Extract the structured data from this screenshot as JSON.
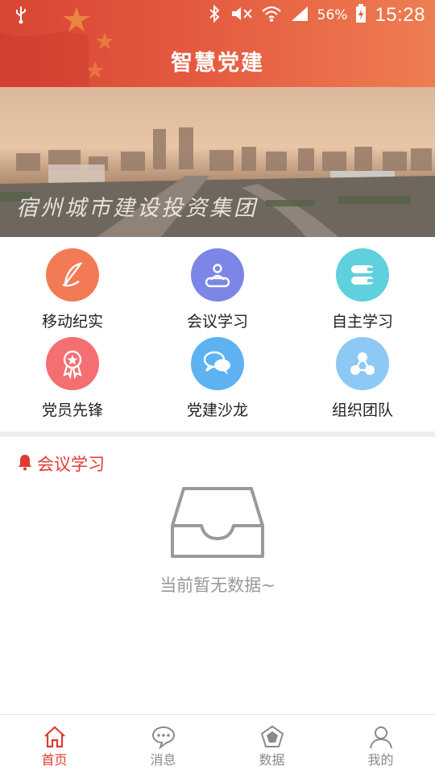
{
  "status_bar": {
    "usb_icon": "usb-icon",
    "battery_percent": "56%",
    "time": "15:28"
  },
  "header": {
    "title": "智慧党建"
  },
  "banner": {
    "caption": "宿州城市建设投资集团"
  },
  "grid": [
    {
      "label": "移动纪实",
      "icon": "quill-icon",
      "color": "#f27b56"
    },
    {
      "label": "会议学习",
      "icon": "meeting-icon",
      "color": "#7c86e6"
    },
    {
      "label": "自主学习",
      "icon": "book-icon",
      "color": "#5fd0dd"
    },
    {
      "label": "党员先锋",
      "icon": "medal-icon",
      "color": "#f36f72"
    },
    {
      "label": "党建沙龙",
      "icon": "chat-bubbles-icon",
      "color": "#5eb2f1"
    },
    {
      "label": "组织团队",
      "icon": "network-icon",
      "color": "#8ec8f5"
    }
  ],
  "section": {
    "title": "会议学习",
    "icon": "bell-icon"
  },
  "empty_state": {
    "message": "当前暂无数据~",
    "icon": "inbox-tray-icon"
  },
  "bottom_nav": [
    {
      "label": "首页",
      "icon": "home-icon",
      "active": true
    },
    {
      "label": "消息",
      "icon": "message-icon",
      "active": false
    },
    {
      "label": "数据",
      "icon": "data-icon",
      "active": false
    },
    {
      "label": "我的",
      "icon": "person-icon",
      "active": false
    }
  ],
  "colors": {
    "accent": "#e23a32",
    "header_start": "#d94534",
    "header_end": "#ee7d52"
  }
}
